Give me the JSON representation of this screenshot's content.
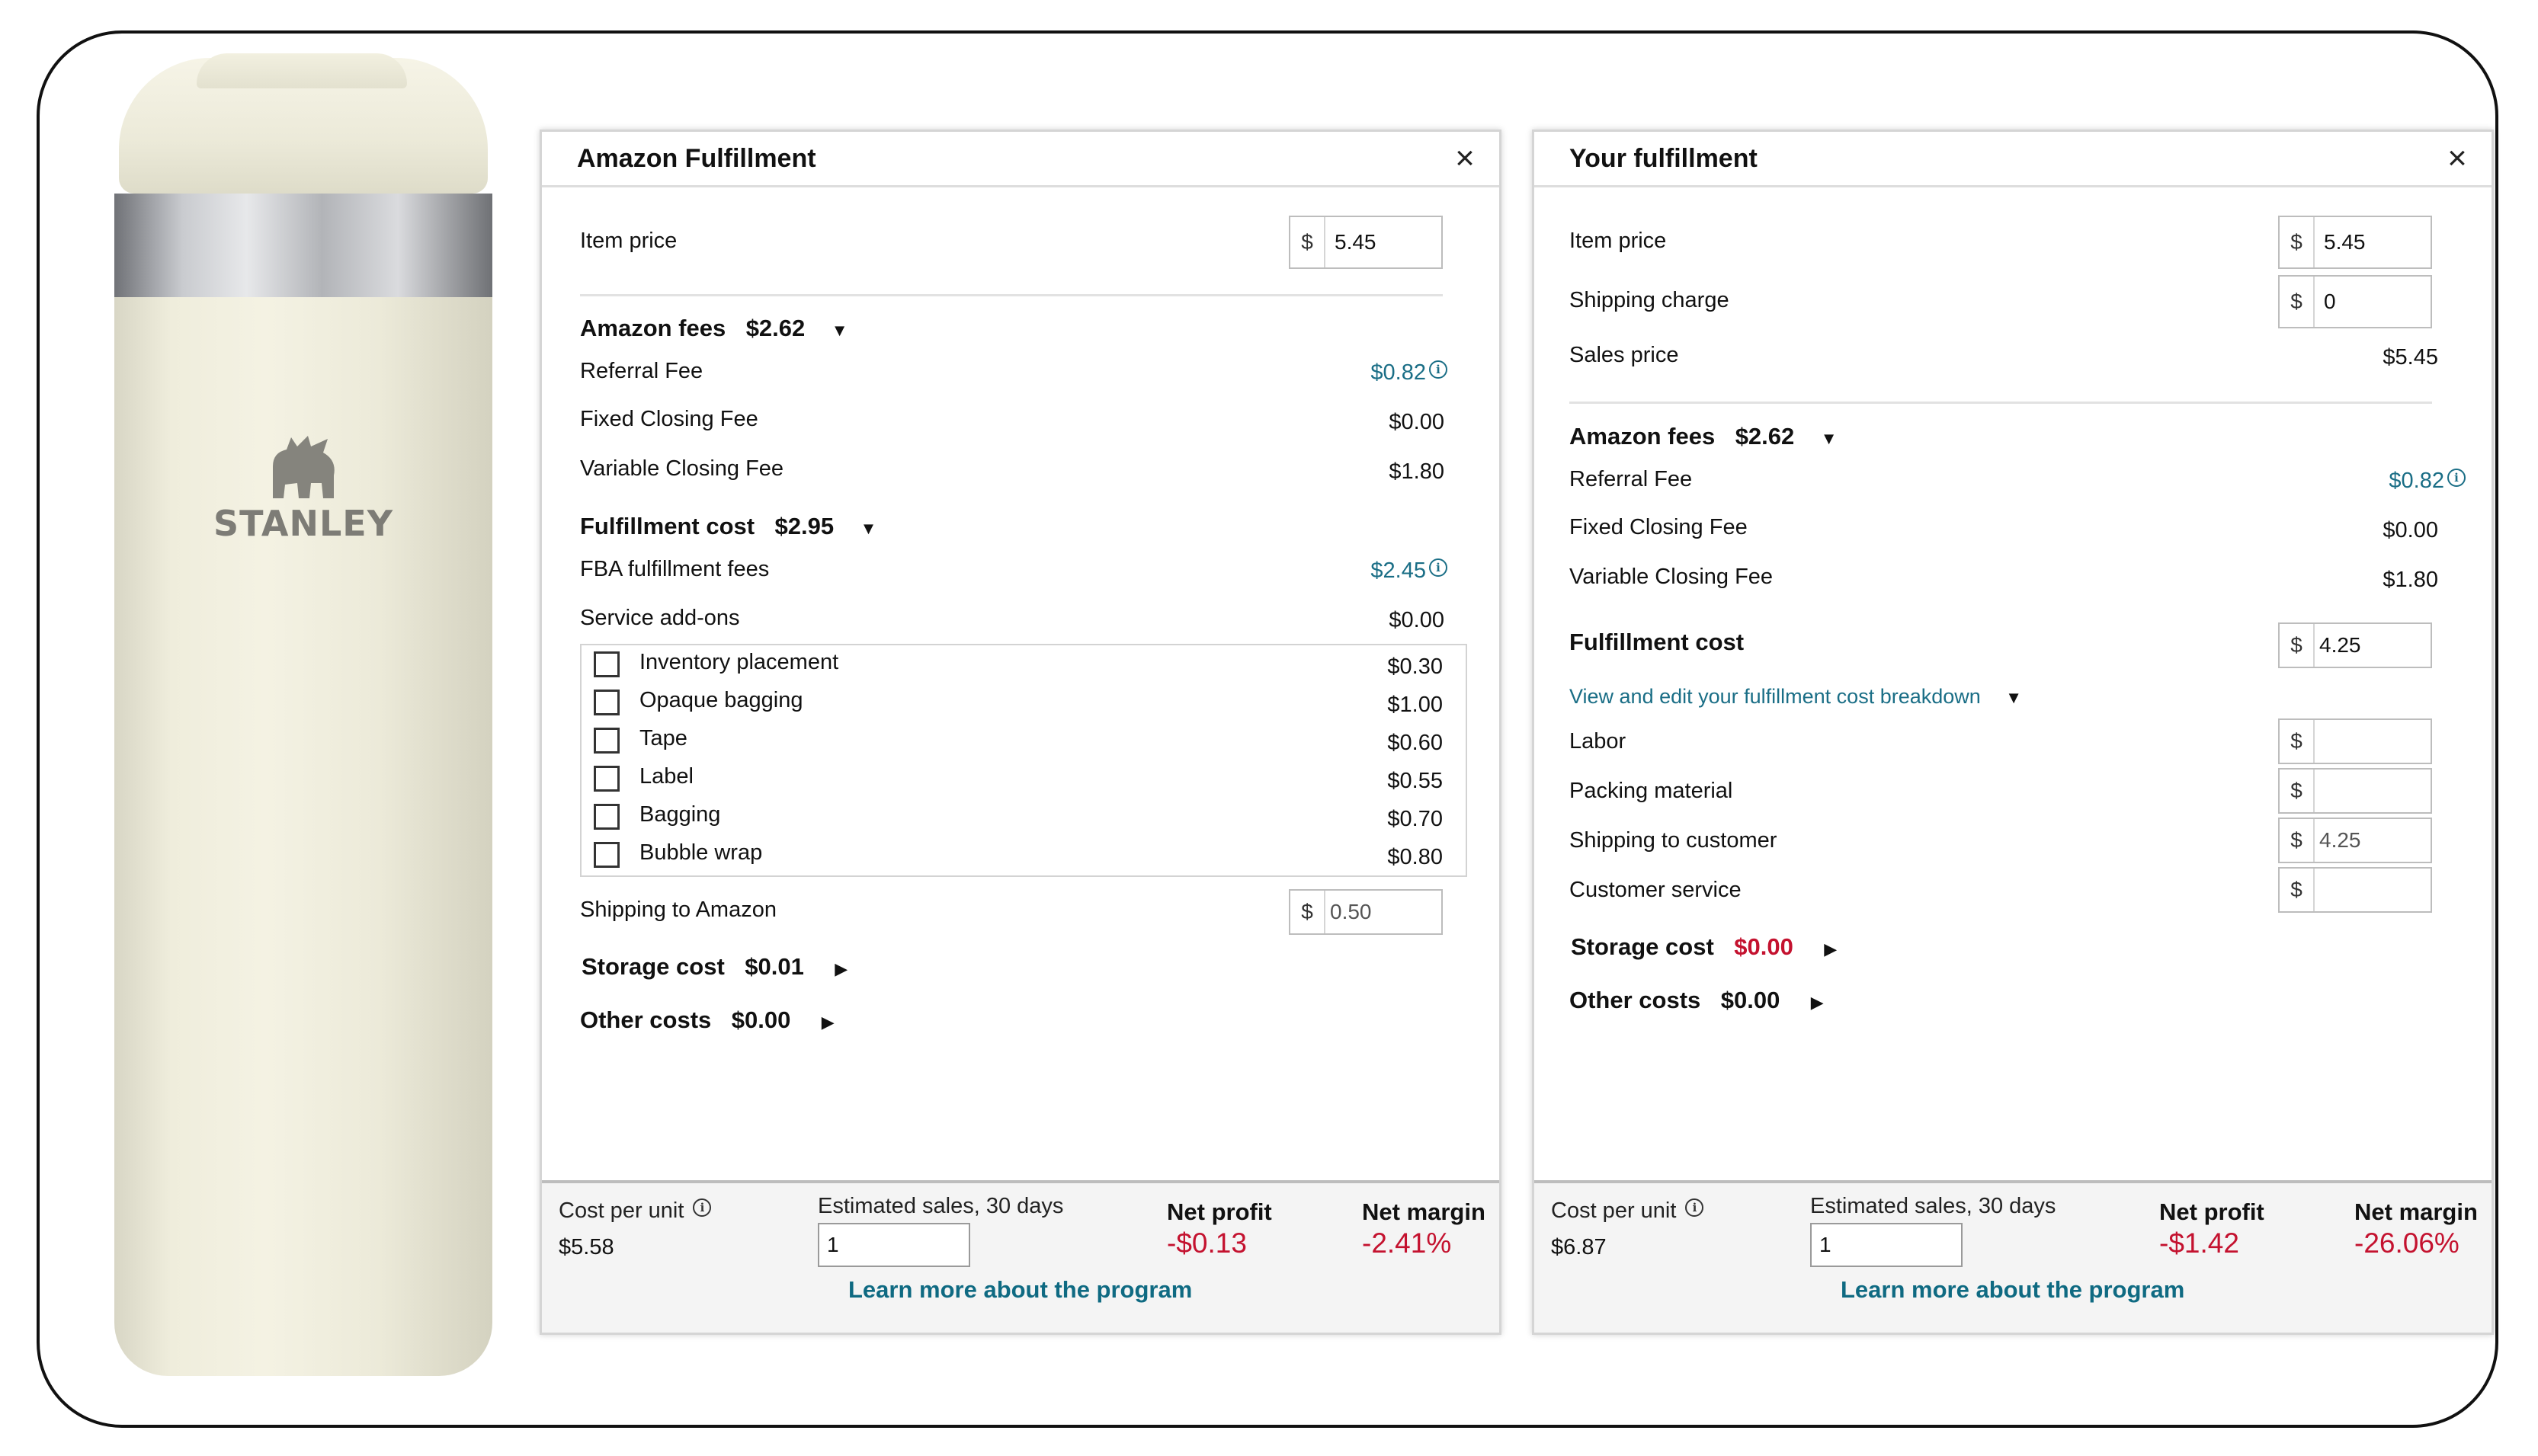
{
  "product": {
    "brand_logo_text": "STANLEY"
  },
  "left": {
    "title": "Amazon Fulfillment",
    "close": "×",
    "item_price": {
      "label": "Item price",
      "currency": "$",
      "value": "5.45"
    },
    "amazon_fees": {
      "label": "Amazon fees",
      "total": "$2.62",
      "rows": [
        {
          "label": "Referral Fee",
          "value": "$0.82"
        },
        {
          "label": "Fixed Closing Fee",
          "value": "$0.00"
        },
        {
          "label": "Variable Closing Fee",
          "value": "$1.80"
        }
      ]
    },
    "fulfillment": {
      "label": "Fulfillment cost",
      "total": "$2.95",
      "fba_label": "FBA fulfillment fees",
      "fba_value": "$2.45",
      "addons_label": "Service add-ons",
      "addons_value": "$0.00",
      "addons": [
        {
          "label": "Inventory placement",
          "value": "$0.30",
          "checked": false
        },
        {
          "label": "Opaque bagging",
          "value": "$1.00",
          "checked": false
        },
        {
          "label": "Tape",
          "value": "$0.60",
          "checked": false
        },
        {
          "label": "Label",
          "value": "$0.55",
          "checked": false
        },
        {
          "label": "Bagging",
          "value": "$0.70",
          "checked": false
        },
        {
          "label": "Bubble wrap",
          "value": "$0.80",
          "checked": false
        }
      ],
      "shipping_label": "Shipping to Amazon",
      "shipping_currency": "$",
      "shipping_value": "0.50"
    },
    "storage": {
      "label": "Storage cost",
      "value": "$0.01"
    },
    "other": {
      "label": "Other costs",
      "value": "$0.00"
    },
    "footer": {
      "cost_label": "Cost per unit",
      "cost_value": "$5.58",
      "sales_label": "Estimated sales, 30 days",
      "sales_value": "1",
      "profit_label": "Net profit",
      "profit_value": "-$0.13",
      "margin_label": "Net margin",
      "margin_value": "-2.41%",
      "learn_more": "Learn more about the program"
    }
  },
  "right": {
    "title": "Your fulfillment",
    "close": "×",
    "item_price": {
      "label": "Item price",
      "currency": "$",
      "value": "5.45"
    },
    "shipping_charge": {
      "label": "Shipping charge",
      "currency": "$",
      "value": "0"
    },
    "sales_price": {
      "label": "Sales price",
      "value": "$5.45"
    },
    "amazon_fees": {
      "label": "Amazon fees",
      "total": "$2.62",
      "rows": [
        {
          "label": "Referral Fee",
          "value": "$0.82"
        },
        {
          "label": "Fixed Closing Fee",
          "value": "$0.00"
        },
        {
          "label": "Variable Closing Fee",
          "value": "$1.80"
        }
      ]
    },
    "fulfillment": {
      "label": "Fulfillment cost",
      "currency": "$",
      "value": "4.25",
      "breakdown_link": "View and edit your fulfillment cost breakdown",
      "breakdown": [
        {
          "label": "Labor",
          "currency": "$",
          "value": ""
        },
        {
          "label": "Packing material",
          "currency": "$",
          "value": ""
        },
        {
          "label": "Shipping to customer",
          "currency": "$",
          "value": "4.25"
        },
        {
          "label": "Customer service",
          "currency": "$",
          "value": ""
        }
      ]
    },
    "storage": {
      "label": "Storage cost",
      "value": "$0.00"
    },
    "other": {
      "label": "Other costs",
      "value": "$0.00"
    },
    "footer": {
      "cost_label": "Cost per unit",
      "cost_value": "$6.87",
      "sales_label": "Estimated sales, 30 days",
      "sales_value": "1",
      "profit_label": "Net profit",
      "profit_value": "-$1.42",
      "margin_label": "Net margin",
      "margin_value": "-26.06%",
      "learn_more": "Learn more about the program"
    }
  },
  "icons": {
    "caret_down": "▼",
    "caret_right": "▶",
    "info": "i"
  }
}
